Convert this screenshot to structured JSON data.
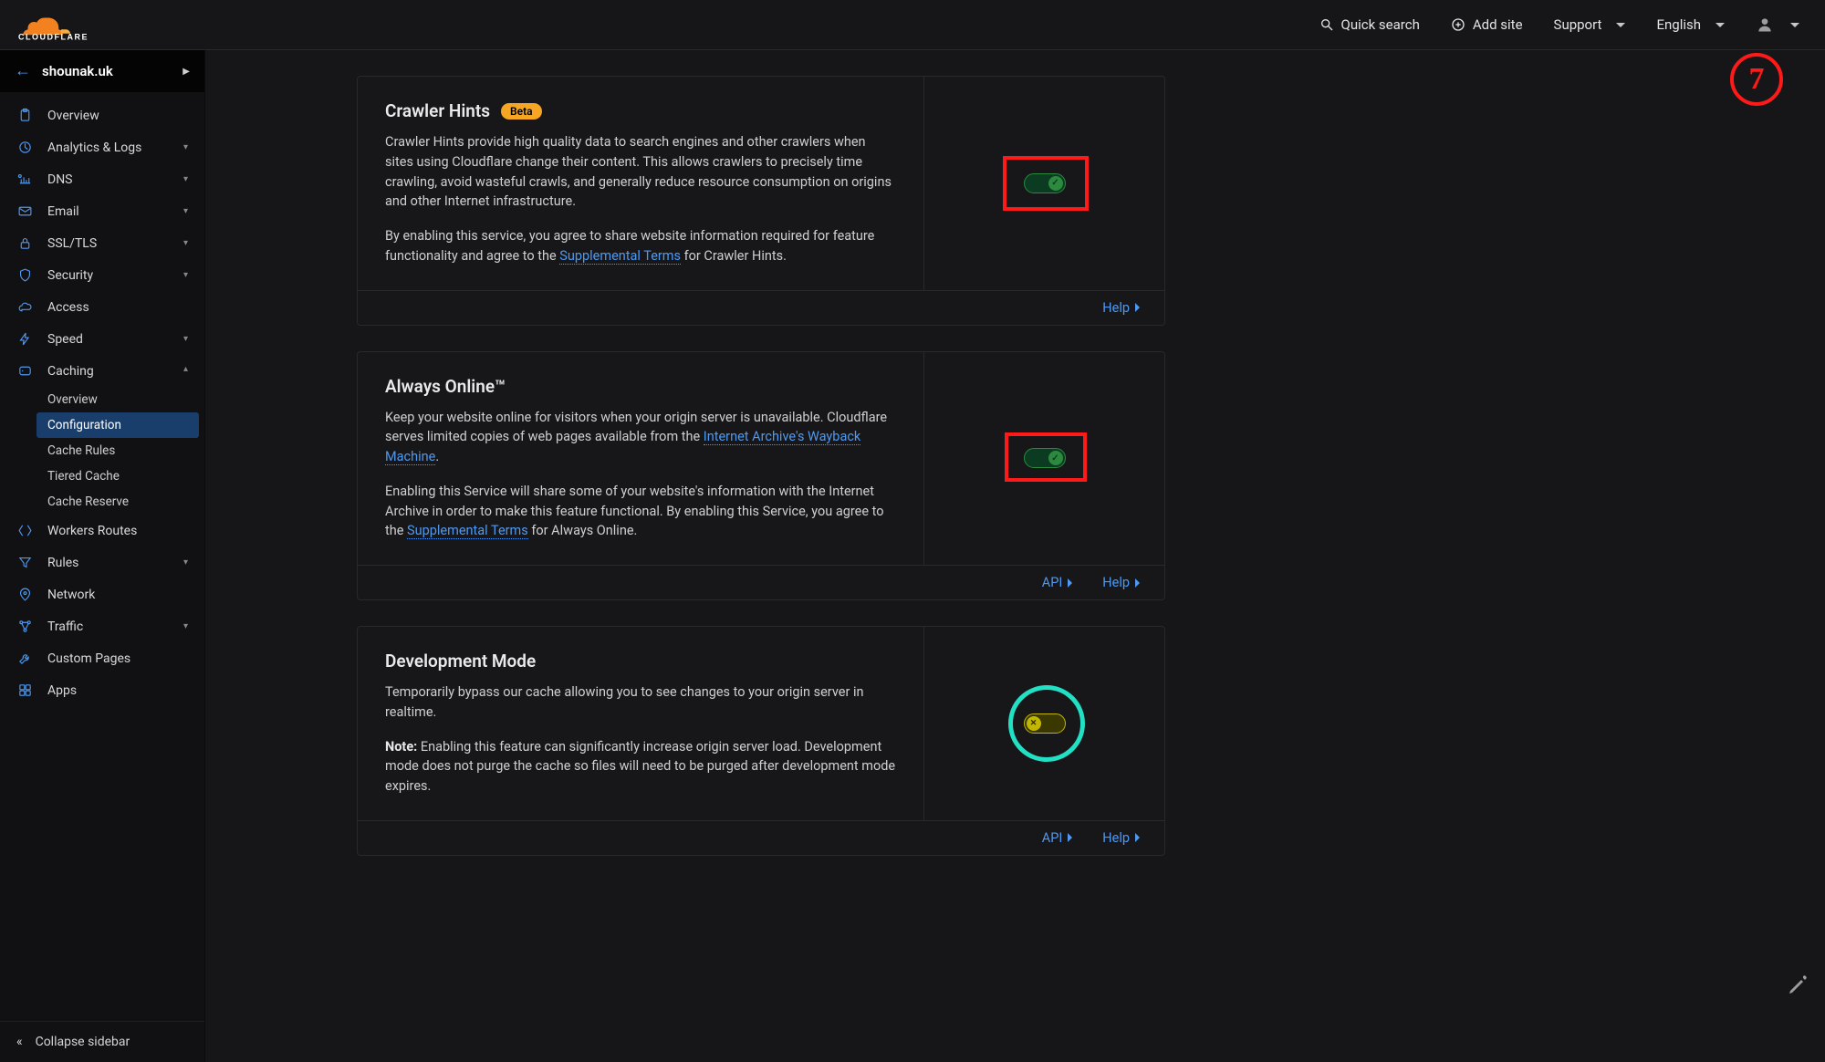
{
  "brand": "CLOUDFLARE",
  "topbar": {
    "search": "Quick search",
    "add_site": "Add site",
    "support": "Support",
    "language": "English"
  },
  "site": {
    "name": "shounak.uk"
  },
  "sidebar": {
    "items": [
      {
        "label": "Overview",
        "icon": "clipboard",
        "chevron": false
      },
      {
        "label": "Analytics & Logs",
        "icon": "chart",
        "chevron": true
      },
      {
        "label": "DNS",
        "icon": "dns",
        "chevron": true
      },
      {
        "label": "Email",
        "icon": "mail",
        "chevron": true
      },
      {
        "label": "SSL/TLS",
        "icon": "lock",
        "chevron": true
      },
      {
        "label": "Security",
        "icon": "shield",
        "chevron": true
      },
      {
        "label": "Access",
        "icon": "cloud",
        "chevron": false
      },
      {
        "label": "Speed",
        "icon": "bolt",
        "chevron": true
      },
      {
        "label": "Caching",
        "icon": "drive",
        "chevron": true,
        "expanded": true
      },
      {
        "label": "Workers Routes",
        "icon": "workers",
        "chevron": false
      },
      {
        "label": "Rules",
        "icon": "funnel",
        "chevron": true
      },
      {
        "label": "Network",
        "icon": "pin",
        "chevron": false
      },
      {
        "label": "Traffic",
        "icon": "traffic",
        "chevron": true
      },
      {
        "label": "Custom Pages",
        "icon": "wrench",
        "chevron": false
      },
      {
        "label": "Apps",
        "icon": "apps",
        "chevron": false
      }
    ],
    "caching_sub": [
      {
        "label": "Overview",
        "active": false
      },
      {
        "label": "Configuration",
        "active": true
      },
      {
        "label": "Cache Rules",
        "active": false
      },
      {
        "label": "Tiered Cache",
        "active": false
      },
      {
        "label": "Cache Reserve",
        "active": false
      }
    ],
    "collapse": "Collapse sidebar"
  },
  "cards": [
    {
      "title": "Crawler Hints",
      "badge": "Beta",
      "p1": "Crawler Hints provide high quality data to search engines and other crawlers when sites using Cloudflare change their content. This allows crawlers to precisely time crawling, avoid wasteful crawls, and generally reduce resource consumption on origins and other Internet infrastructure.",
      "p2a": "By enabling this service, you agree to share website information required for feature functionality and agree to the ",
      "link": "Supplemental Terms",
      "p2b": " for Crawler Hints.",
      "toggle": "on",
      "footer": {
        "api": false,
        "help": "Help"
      },
      "anno": "red"
    },
    {
      "title": "Always Online™",
      "p1a": "Keep your website online for visitors when your origin server is unavailable. Cloudflare serves limited copies of web pages available from the ",
      "link1": "Internet Archive's Wayback Machine",
      "p1b": ".",
      "p2a": "Enabling this Service will share some of your website's information with the Internet Archive in order to make this feature functional. By enabling this Service, you agree to the ",
      "link2": "Supplemental Terms",
      "p2b": " for Always Online.",
      "toggle": "on",
      "footer": {
        "api": "API",
        "help": "Help"
      },
      "anno": "red"
    },
    {
      "title": "Development Mode",
      "p1": "Temporarily bypass our cache allowing you to see changes to your origin server in realtime.",
      "note_label": "Note:",
      "p2": " Enabling this feature can significantly increase origin server load. Development mode does not purge the cache so files will need to be purged after development mode expires.",
      "toggle": "off",
      "footer": {
        "api": "API",
        "help": "Help"
      },
      "anno": "teal"
    }
  ],
  "annotation_number": "7"
}
